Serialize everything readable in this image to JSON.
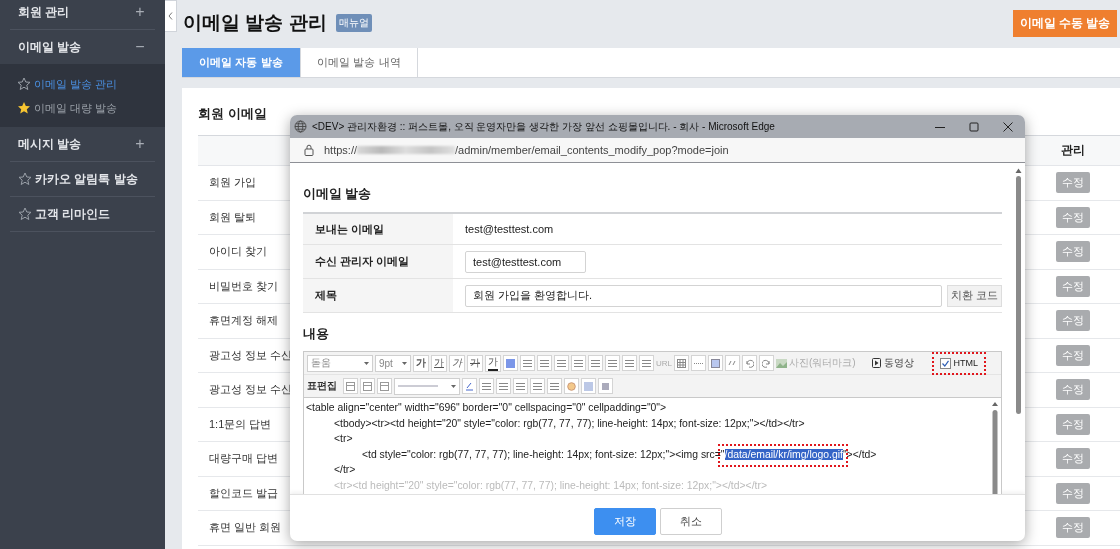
{
  "sidebar": {
    "items": [
      {
        "kind": "group",
        "label": "회원 관리",
        "toggle": "+",
        "expanded": false
      },
      {
        "kind": "group",
        "label": "이메일 발송",
        "toggle": "−",
        "expanded": true,
        "children": [
          {
            "label": "이메일 발송 관리",
            "selected": true,
            "favorite": false
          },
          {
            "label": "이메일 대량 발송",
            "selected": false,
            "favorite": true
          }
        ]
      },
      {
        "kind": "group",
        "label": "메시지 발송",
        "toggle": "+",
        "expanded": false
      },
      {
        "kind": "link",
        "label": "카카오 알림톡 발송",
        "favorite": false
      },
      {
        "kind": "link",
        "label": "고객 리마인드",
        "favorite": false
      }
    ]
  },
  "header": {
    "title": "이메일 발송 관리",
    "badge": "매뉴얼",
    "action_button": "이메일 수동 발송"
  },
  "tabs": [
    {
      "label": "이메일 자동 발송",
      "selected": true
    },
    {
      "label": "이메일 발송 내역",
      "selected": false
    }
  ],
  "card": {
    "title": "회원 이메일",
    "columns": [
      "관리"
    ],
    "rows": [
      {
        "name": "회원 가입",
        "action": "수정"
      },
      {
        "name": "회원 탈퇴",
        "action": "수정"
      },
      {
        "name": "아이디 찾기",
        "action": "수정"
      },
      {
        "name": "비밀번호 찾기",
        "action": "수정"
      },
      {
        "name": "휴면계정 해제",
        "action": "수정"
      },
      {
        "name": "광고성 정보 수신",
        "action": "수정"
      },
      {
        "name": "광고성 정보 수신",
        "action": "수정"
      },
      {
        "name": "1:1문의 답변",
        "action": "수정"
      },
      {
        "name": "대량구매 답변",
        "action": "수정"
      },
      {
        "name": "할인코드 발급",
        "action": "수정"
      },
      {
        "name": "휴면 일반 회원",
        "action": "수정"
      }
    ]
  },
  "popup": {
    "title": "<DEV> 관리자환경 :: 퍼스트몰, 오직 운영자만을 생각한 가장 앞선 쇼핑몰입니다. - 회사 - Microsoft Edge",
    "url_scheme": "https://",
    "url_path": "/admin/member/email_contents_modify_pop?mode=join",
    "heading": "이메일 발송",
    "fields": [
      {
        "kind": "static",
        "label": "보내는 이메일",
        "value": "test@testtest.com"
      },
      {
        "kind": "input",
        "label": "수신 관리자 이메일",
        "value": "test@testtest.com"
      },
      {
        "kind": "input_button",
        "label": "제목",
        "value": "회원 가입을 환영합니다.",
        "button": "치환 코드"
      }
    ],
    "content_label": "내용",
    "editor": {
      "font_select": "돋움",
      "size_select": "9pt",
      "format_buttons": [
        {
          "label": "가"
        },
        {
          "label": "가"
        },
        {
          "label": "가"
        },
        {
          "label": "가"
        },
        {
          "label": "가"
        }
      ],
      "url_button": "URL",
      "photo_button": "사진(워터마크)",
      "video_button": "동영상",
      "html_toggle": {
        "label": "HTML",
        "checked": true,
        "highlighted": true
      },
      "table_label": "표편집",
      "code_lines": [
        {
          "text": "<table align=\"center\" width=\"696\" border=\"0\" cellspacing=\"0\" cellpadding=\"0\">"
        },
        {
          "text": "\t<tbody><tr><td height=\"20\" style=\"color: rgb(77, 77, 77); line-height: 14px; font-size: 12px;\"></td></tr>"
        },
        {
          "text": "\t<tr>"
        },
        {
          "text": "\t\t<td style=\"color: rgb(77, 77, 77); line-height: 14px; font-size: 12px;\"><img src=\"",
          "selection": {
            "text": "/data/email/kr/img/logo.gif",
            "highlighted": true
          },
          "after": "\"></td>"
        },
        {
          "text": "\t</tr>"
        },
        {
          "text": "\t<tr><td height=\"20\" style=\"color: rgb(77, 77, 77); line-height: 14px; font-size: 12px;\"></td></tr>"
        }
      ]
    },
    "buttons": [
      {
        "label": "저장",
        "kind": "primary"
      },
      {
        "label": "취소",
        "kind": "secondary"
      }
    ]
  }
}
